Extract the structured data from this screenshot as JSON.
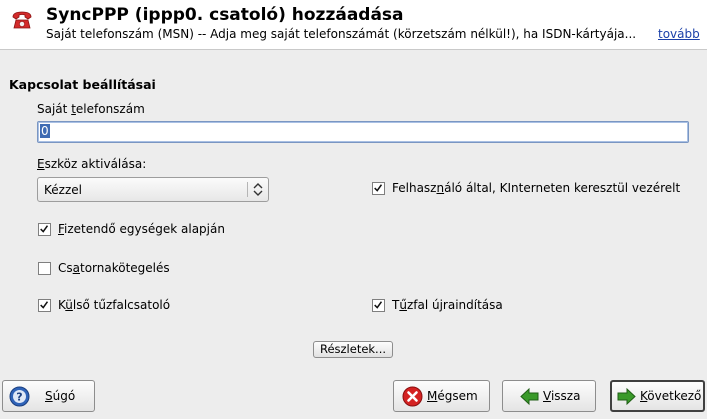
{
  "header": {
    "title": "SyncPPP (ippp0. csatoló) hozzáadása",
    "description": "Saját telefonszám (MSN) -- Adja meg saját telefonszámát (körzetszám nélkül!), ha ISDN-kártyája...",
    "more_link": "tovább",
    "icon": "telephone-icon"
  },
  "section": {
    "title": "Kapcsolat beállításai"
  },
  "phone": {
    "label_pre": "Saját ",
    "label_mnemonic": "t",
    "label_post": "elefonszám",
    "value": "0"
  },
  "activation": {
    "label_mnemonic": "E",
    "label_post": "szköz aktiválása:",
    "selected": "Kézzel"
  },
  "checkboxes": {
    "user_control": {
      "label_pre": "Felhasz",
      "label_mnemonic": "n",
      "label_post": "áló által, KInterneten keresztül vezérelt",
      "checked": true
    },
    "charge_units": {
      "label_pre": "",
      "label_mnemonic": "F",
      "label_post": "izetendő egységek alapján",
      "checked": true
    },
    "channel_bundling": {
      "label_pre": "Cs",
      "label_mnemonic": "a",
      "label_post": "tornakötegelés",
      "checked": false
    },
    "external_firewall": {
      "label_pre": "K",
      "label_mnemonic": "ü",
      "label_post": "lső tűzfalcsatoló",
      "checked": true
    },
    "restart_firewall": {
      "label_pre": "T",
      "label_mnemonic": "ű",
      "label_post": "zfal újraindítása",
      "checked": true
    }
  },
  "details_button": {
    "label": "Részletek..."
  },
  "buttons": {
    "help": {
      "label_pre": "",
      "label_mnemonic": "S",
      "label_post": "úgó"
    },
    "cancel": {
      "label_pre": "",
      "label_mnemonic": "M",
      "label_post": "égsem"
    },
    "back": {
      "label_pre": "",
      "label_mnemonic": "V",
      "label_post": "issza"
    },
    "next": {
      "label_pre": "",
      "label_mnemonic": "K",
      "label_post": "övetkező"
    }
  },
  "colors": {
    "link": "#1a3fa8",
    "selection": "#3e6bb3",
    "cancel_icon": "#d42222",
    "arrow_icon": "#3a9a2a",
    "help_icon": "#2f63b8"
  }
}
